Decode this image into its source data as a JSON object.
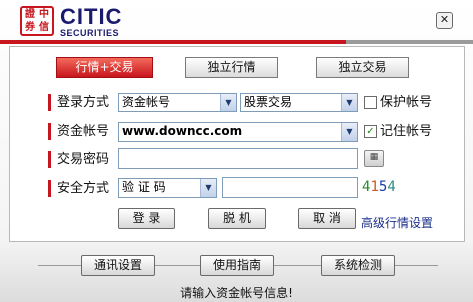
{
  "logo": {
    "glyph1": "證",
    "glyph2": "中",
    "glyph3": "券",
    "glyph4": "信"
  },
  "brand": {
    "name": "CITIC",
    "sub": "SECURITIES"
  },
  "window": {
    "close_symbol": "✕"
  },
  "tabs": [
    {
      "label": "行情+交易"
    },
    {
      "label": "独立行情"
    },
    {
      "label": "独立交易"
    }
  ],
  "form": {
    "login_method": {
      "label": "登录方式",
      "type_value": "资金帐号",
      "mode_value": "股票交易"
    },
    "account": {
      "label": "资金帐号",
      "value": "www.downcc.com"
    },
    "password": {
      "label": "交易密码",
      "value": ""
    },
    "security": {
      "label": "安全方式",
      "method_value": "验 证 码",
      "code_value": ""
    },
    "protect_account": {
      "label": "保护帐号",
      "checked": false
    },
    "remember_account": {
      "label": "记住帐号",
      "checked": true,
      "mark": "✓"
    },
    "captcha": {
      "d1": "4",
      "d2": "1",
      "d3": "5",
      "d4": "4",
      "colors": [
        "#2a8a2a",
        "#d0541a",
        "#1a3aa0",
        "#2a8a8a"
      ]
    },
    "keyboard_icon": "▦"
  },
  "actions": {
    "login": "登 录",
    "offline": "脱 机",
    "cancel": "取 消",
    "advanced_link": "高级行情设置"
  },
  "footer": {
    "comm_settings": "通讯设置",
    "user_guide": "使用指南",
    "system_check": "系统检测"
  },
  "status": {
    "message": "请输入资金帐号信息!"
  },
  "colors": {
    "accent": "#c8161e",
    "brand": "#1a1a6e"
  }
}
